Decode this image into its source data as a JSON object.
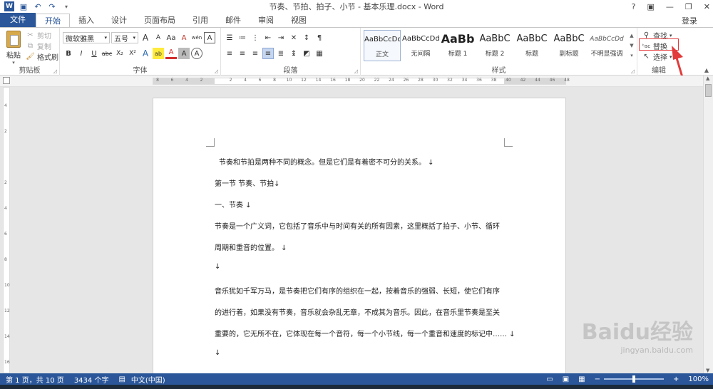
{
  "app": {
    "title": "节奏、节拍、拍子、小节 - 基本乐理.docx - Word",
    "login": "登录",
    "win_help": "?",
    "win_ribbon": "▣",
    "win_min": "—",
    "win_max": "❐",
    "win_close": "✕",
    "accent": "#2b579a"
  },
  "qat": {
    "save_icon": "save-icon",
    "undo_icon": "undo-icon",
    "redo_icon": "redo-icon"
  },
  "tabs": [
    "文件",
    "开始",
    "插入",
    "设计",
    "页面布局",
    "引用",
    "邮件",
    "审阅",
    "视图"
  ],
  "ribbon": {
    "clipboard": {
      "label": "剪贴板",
      "paste": "粘贴",
      "cut": "剪切",
      "copy": "复制",
      "format_painter": "格式刷"
    },
    "font": {
      "label": "字体",
      "font_name": "微软雅黑",
      "font_size": "五号",
      "grow": "A",
      "shrink": "A",
      "case": "Aa",
      "clear": "A",
      "phonetic": "wén",
      "border": "A",
      "bold": "B",
      "italic": "I",
      "underline": "U",
      "strike": "abc",
      "sub": "X₂",
      "sup": "X²",
      "effects": "A",
      "highlight": "ab",
      "color": "A",
      "shade": "A",
      "enclose": "A"
    },
    "paragraph": {
      "label": "段落"
    },
    "styles": {
      "label": "样式",
      "items": [
        {
          "sample": "AaBbCcDd",
          "name": "正文"
        },
        {
          "sample": "AaBbCcDd",
          "name": "无间隔"
        },
        {
          "sample": "AaBb",
          "name": "标题 1"
        },
        {
          "sample": "AaBbC",
          "name": "标题 2"
        },
        {
          "sample": "AaBbC",
          "name": "标题"
        },
        {
          "sample": "AaBbC",
          "name": "副标题"
        },
        {
          "sample": "AaBbCcDd",
          "name": "不明显强调"
        }
      ]
    },
    "editing": {
      "label": "编辑",
      "find": "查找",
      "replace": "替换",
      "select": "选择"
    }
  },
  "ruler": {
    "ticks": [
      "8",
      "6",
      "4",
      "2",
      "",
      "2",
      "4",
      "6",
      "8",
      "10",
      "12",
      "14",
      "16",
      "18",
      "20",
      "22",
      "24",
      "26",
      "28",
      "30",
      "32",
      "34",
      "36",
      "38",
      "40",
      "42",
      "44",
      "46",
      "48"
    ],
    "vticks": [
      "4",
      "2",
      "",
      "2",
      "4",
      "6",
      "8",
      "10",
      "12",
      "14",
      "16"
    ]
  },
  "document": {
    "paragraphs": [
      "节奏和节拍是两种不同的概念。但是它们是有着密不可分的关系。 ↓",
      "第一节 节奏、节拍↓",
      "一、节奏 ↓",
      "节奏是一个广义词，它包括了音乐中与时间有关的所有因素，这里概括了拍子、小节、循环",
      "周期和重音的位置。 ↓",
      "↓",
      "音乐犹如千军万马，是节奏把它们有序的组织在一起，按着音乐的强弱、长短，使它们有序",
      "的进行着，如果没有节奏，音乐就会杂乱无章，不成其为音乐。因此，在音乐里节奏是至关",
      "重要的，它无所不在，它体现在每一个音符，每一个小节线，每一个重音和速度的标记中…… ↓",
      "↓"
    ]
  },
  "status": {
    "page": "第 1 页，共 10 页",
    "words": "3434 个字",
    "lang": "中文(中国)",
    "zoom": "100%",
    "zoom_minus": "−",
    "zoom_plus": "+"
  },
  "watermark": {
    "brand": "Baidu经验",
    "url": "jingyan.baidu.com"
  }
}
